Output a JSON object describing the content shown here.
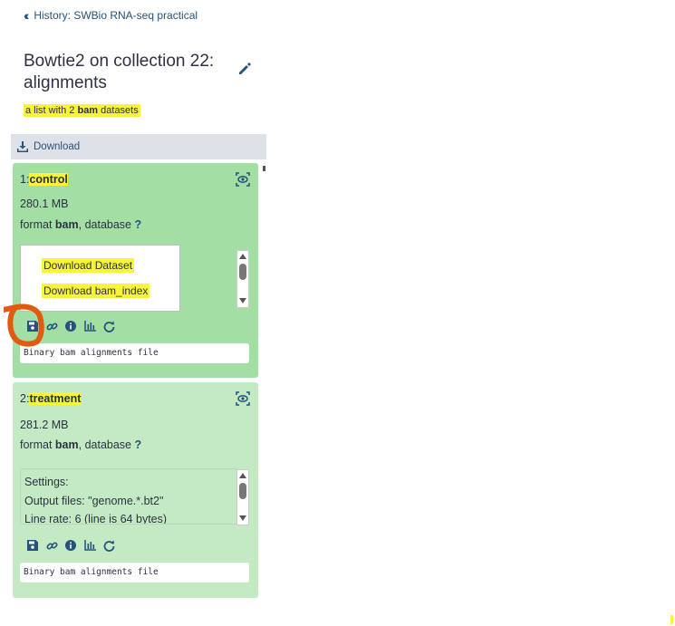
{
  "nav": {
    "back_label": "History: SWBio RNA-seq practical"
  },
  "collection": {
    "title": "Bowtie2 on collection 22: alignments",
    "summary_pre": "a list with 2 ",
    "summary_bold": "bam",
    "summary_post": " datasets"
  },
  "toolbar": {
    "download_label": "Download"
  },
  "datasets": [
    {
      "index": "1:",
      "name": "control",
      "size": "280.1 MB",
      "format_label": "format",
      "format": "bam",
      "database_label": ",  database",
      "database": "?",
      "download_options": [
        "Download Dataset",
        "Download bam_index"
      ],
      "peek": "Binary bam alignments file"
    },
    {
      "index": "2:",
      "name": "treatment",
      "size": "281.2 MB",
      "format_label": "format",
      "format": "bam",
      "database_label": ",  database",
      "database": "?",
      "info_lines": [
        "Settings:",
        "Output files: \"genome.*.bt2\"",
        "Line rate: 6 (line is 64 bytes)"
      ],
      "peek": "Binary bam alignments file"
    }
  ],
  "colors": {
    "card_expanded": "#a3dfa4",
    "card_ok": "#c4eac4",
    "highlight": "#f7f43a",
    "link": "#25537b",
    "annotation": "#e05a10"
  }
}
